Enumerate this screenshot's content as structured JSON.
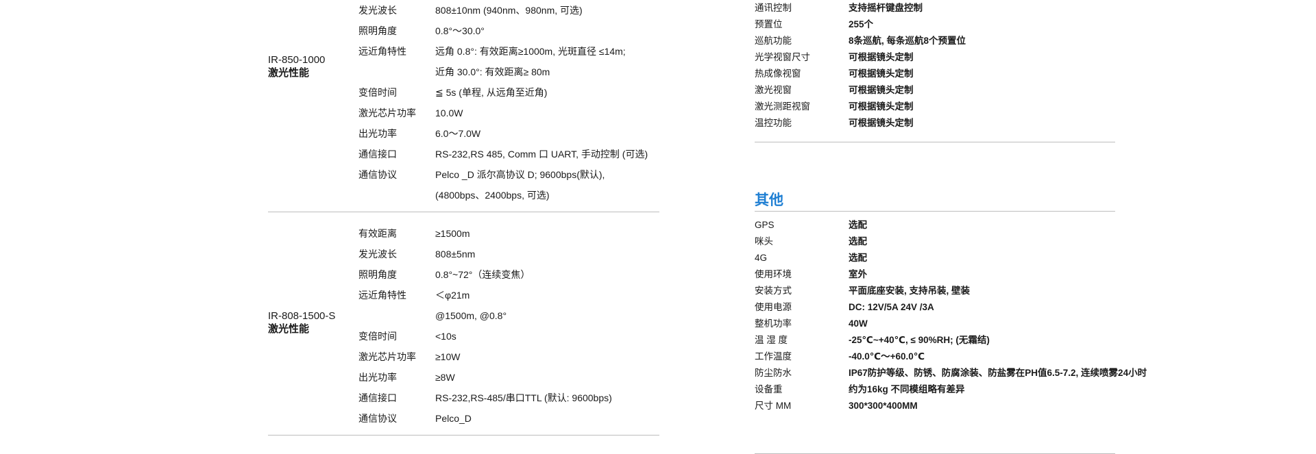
{
  "left": {
    "section1": {
      "model_code": "IR-850-1000",
      "model_name": "激光性能",
      "rows": [
        {
          "label": "发光波长",
          "value": "808±10nm (940nm、980nm, 可选)"
        },
        {
          "label": "照明角度",
          "value": "0.8°～30.0°"
        },
        {
          "label": "远近角特性",
          "value": "远角 0.8°: 有效距离≥1000m, 光斑直径 ≤14m;"
        },
        {
          "label": "",
          "value": "近角 30.0°: 有效距离≥ 80m"
        },
        {
          "label": "变倍时间",
          "value": "≦ 5s (单程, 从远角至近角)"
        },
        {
          "label": "激光芯片功率",
          "value": "10.0W"
        },
        {
          "label": "出光功率",
          "value": "6.0～7.0W"
        },
        {
          "label": "通信接口",
          "value": "RS-232,RS 485, Comm 口 UART, 手动控制 (可选)"
        },
        {
          "label": "通信协议",
          "value": "Pelco _D 派尔高协议 D;   9600bps(默认),"
        },
        {
          "label": "",
          "value": "(4800bps、2400bps, 可选)"
        }
      ]
    },
    "section2": {
      "model_code": "IR-808-1500-S",
      "model_name": "激光性能",
      "rows": [
        {
          "label": "有效距离",
          "value": "≥1500m"
        },
        {
          "label": "发光波长",
          "value": "808±5nm"
        },
        {
          "label": "照明角度",
          "value": "0.8°~72°（连续变焦）"
        },
        {
          "label": "远近角特性",
          "value": "＜φ21m"
        },
        {
          "label": "",
          "value": "@1500m, @0.8°"
        },
        {
          "label": "变倍时间",
          "value": "<10s"
        },
        {
          "label": "激光芯片功率",
          "value": "≥10W"
        },
        {
          "label": "出光功率",
          "value": "≥8W"
        },
        {
          "label": "通信接口",
          "value": "RS-232,RS-485/串口TTL (默认: 9600bps)"
        },
        {
          "label": "通信协议",
          "value": "Pelco_D"
        }
      ]
    }
  },
  "right": {
    "top_rows": [
      {
        "label": "通讯控制",
        "value": "支持摇杆键盘控制"
      },
      {
        "label": "预置位",
        "value": "255个"
      },
      {
        "label": "巡航功能",
        "value": "8条巡航, 每条巡航8个预置位"
      },
      {
        "label": "光学视窗尺寸",
        "value": "可根据镜头定制"
      },
      {
        "label": "热成像视窗",
        "value": "可根据镜头定制"
      },
      {
        "label": "激光视窗",
        "value": "可根据镜头定制"
      },
      {
        "label": "激光测距视窗",
        "value": "可根据镜头定制"
      },
      {
        "label": "温控功能",
        "value": "可根据镜头定制"
      }
    ],
    "other": {
      "heading": "其他",
      "rows": [
        {
          "label": "GPS",
          "value": "选配"
        },
        {
          "label": "咪头",
          "value": "选配"
        },
        {
          "label": "4G",
          "value": "选配"
        },
        {
          "label": "使用环境",
          "value": "室外"
        },
        {
          "label": "安装方式",
          "value": "平面底座安装, 支持吊装, 壁装"
        },
        {
          "label": "使用电源",
          "value": "DC: 12V/5A  24V /3A"
        },
        {
          "label": "整机功率",
          "value": "  40W"
        },
        {
          "label": "温 湿 度",
          "value": "-25℃~+40℃, ≤ 90%RH; (无霜结)"
        },
        {
          "label": "工作温度",
          "value": "-40.0℃～+60.0℃"
        },
        {
          "label": "防尘防水",
          "value": "IP67防护等级、防锈、防腐涂装、防盐雾在PH值6.5-7.2, 连续喷雾24小时"
        },
        {
          "label": "设备重",
          "value": "约为16kg 不同模组略有差异"
        },
        {
          "label": "尺寸 MM",
          "value": "300*300*400MM"
        }
      ]
    }
  }
}
